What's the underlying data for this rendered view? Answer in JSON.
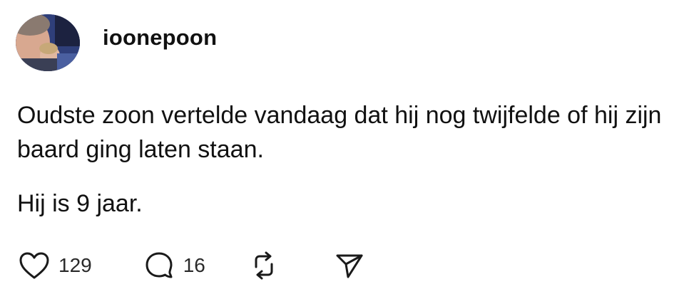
{
  "post": {
    "username": "ioonepoon",
    "paragraphs": [
      "Oudste zoon vertelde vandaag dat hij nog twijfelde of hij zijn baard ging laten staan.",
      "Hij is 9 jaar."
    ],
    "actions": {
      "like_count": "129",
      "reply_count": "16"
    }
  },
  "icons": {
    "like": "heart-icon",
    "reply": "comment-bubble-icon",
    "repost": "repost-icon",
    "share": "send-icon"
  },
  "colors": {
    "text": "#111111",
    "icon_stroke": "#1a1a1a",
    "background": "#ffffff"
  }
}
